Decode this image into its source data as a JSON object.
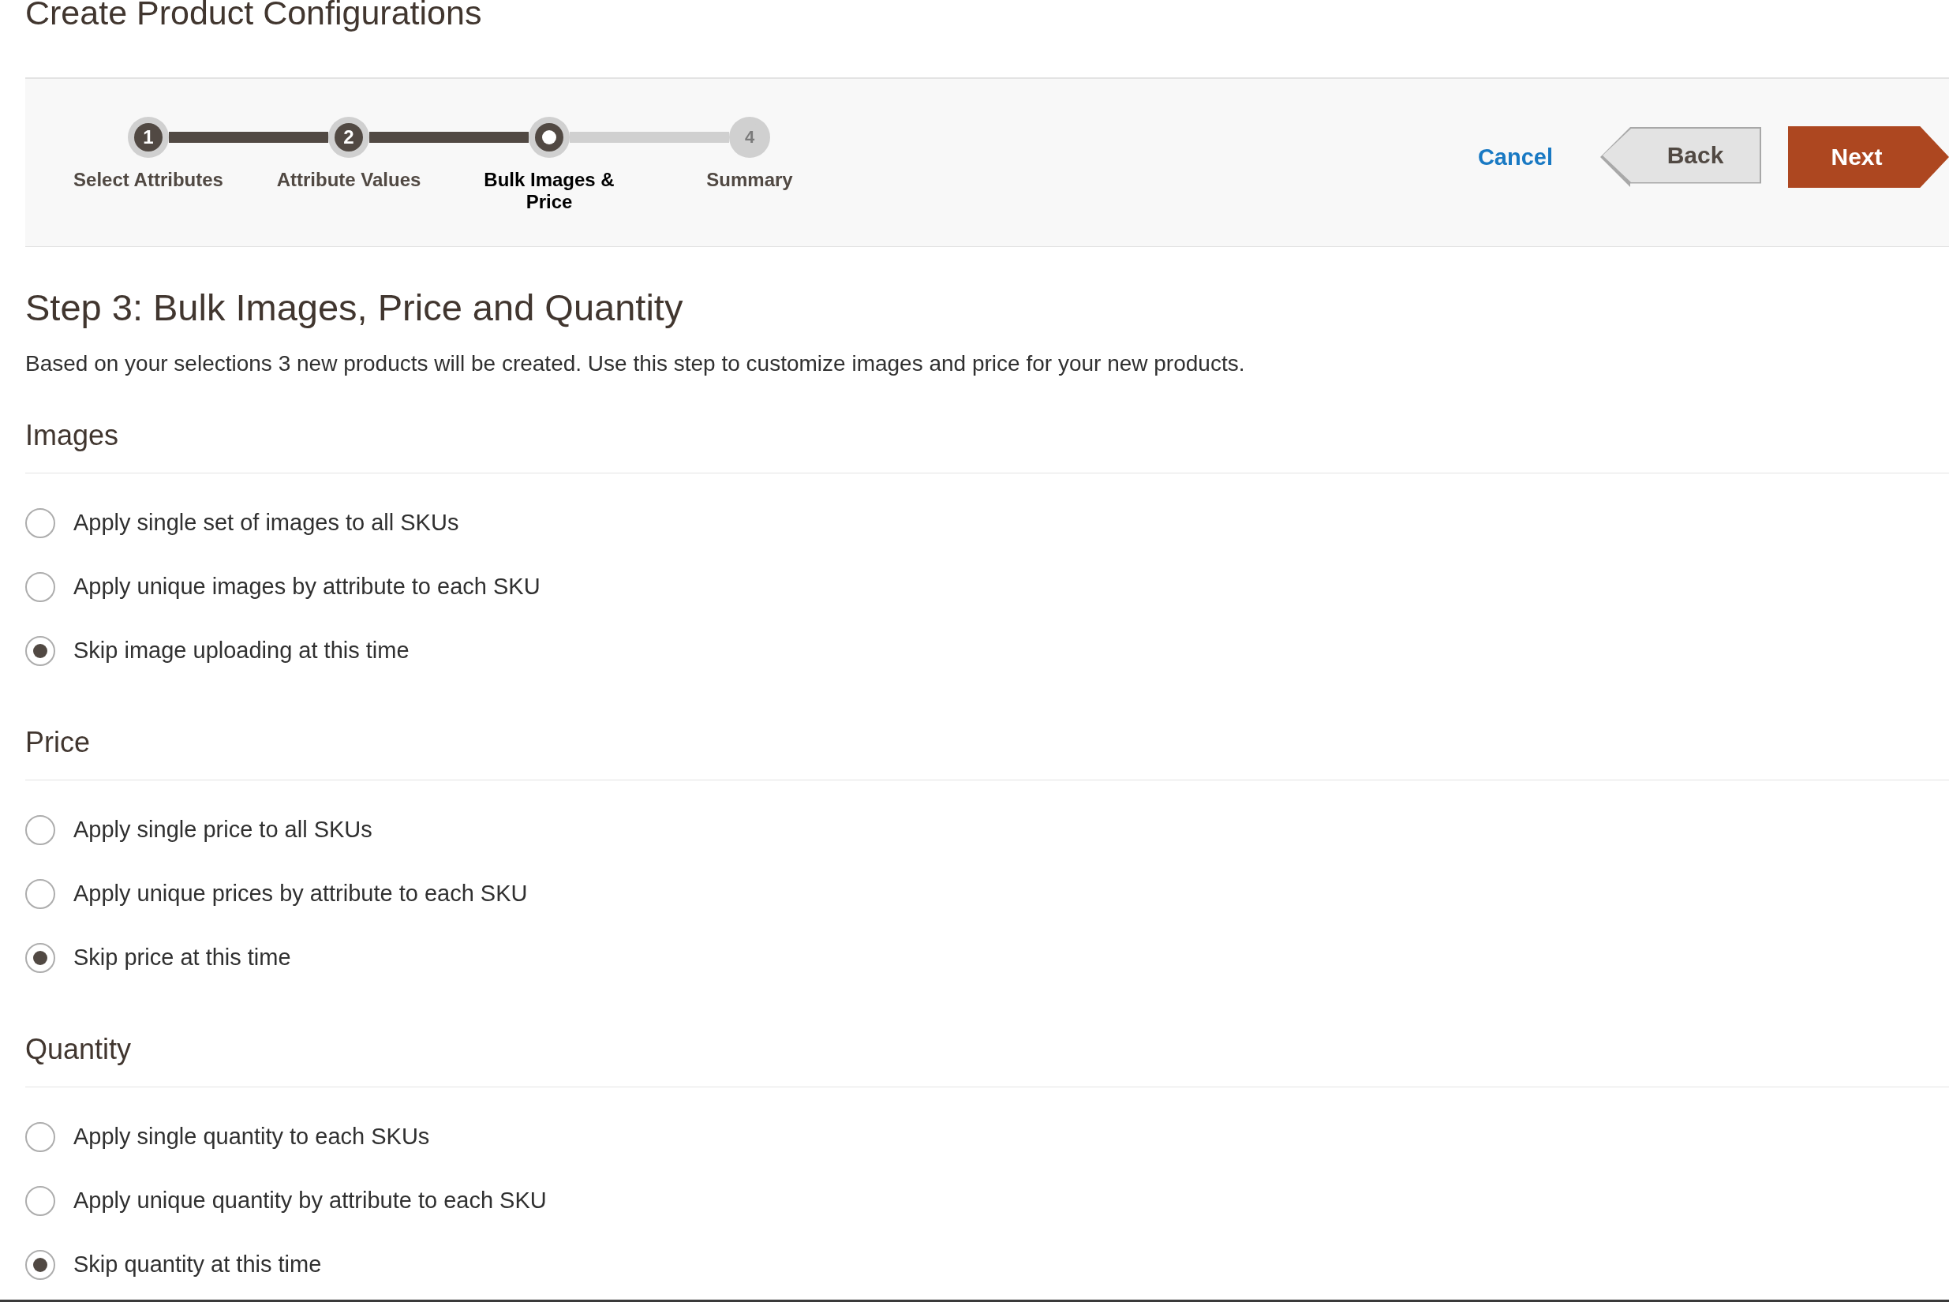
{
  "page_title": "Create Product Configurations",
  "steps": [
    {
      "number": "1",
      "label": "Select Attributes",
      "done": true,
      "selected": false
    },
    {
      "number": "2",
      "label": "Attribute Values",
      "done": true,
      "selected": false
    },
    {
      "label": "Bulk Images & Price",
      "done": false,
      "selected": true
    },
    {
      "number": "4",
      "label": "Summary",
      "done": false,
      "selected": false
    }
  ],
  "actions": {
    "cancel": "Cancel",
    "back": "Back",
    "next": "Next"
  },
  "step_heading": "Step 3: Bulk Images, Price and Quantity",
  "description": "Based on your selections 3 new products will be created. Use this step to customize images and price for your new products.",
  "sections": [
    {
      "title": "Images",
      "options": [
        {
          "label": "Apply single set of images to all SKUs",
          "selected": false
        },
        {
          "label": "Apply unique images by attribute to each SKU",
          "selected": false
        },
        {
          "label": "Skip image uploading at this time",
          "selected": true
        }
      ]
    },
    {
      "title": "Price",
      "options": [
        {
          "label": "Apply single price to all SKUs",
          "selected": false
        },
        {
          "label": "Apply unique prices by attribute to each SKU",
          "selected": false
        },
        {
          "label": "Skip price at this time",
          "selected": true
        }
      ]
    },
    {
      "title": "Quantity",
      "options": [
        {
          "label": "Apply single quantity to each SKUs",
          "selected": false
        },
        {
          "label": "Apply unique quantity by attribute to each SKU",
          "selected": false
        },
        {
          "label": "Skip quantity at this time",
          "selected": true
        }
      ]
    }
  ]
}
